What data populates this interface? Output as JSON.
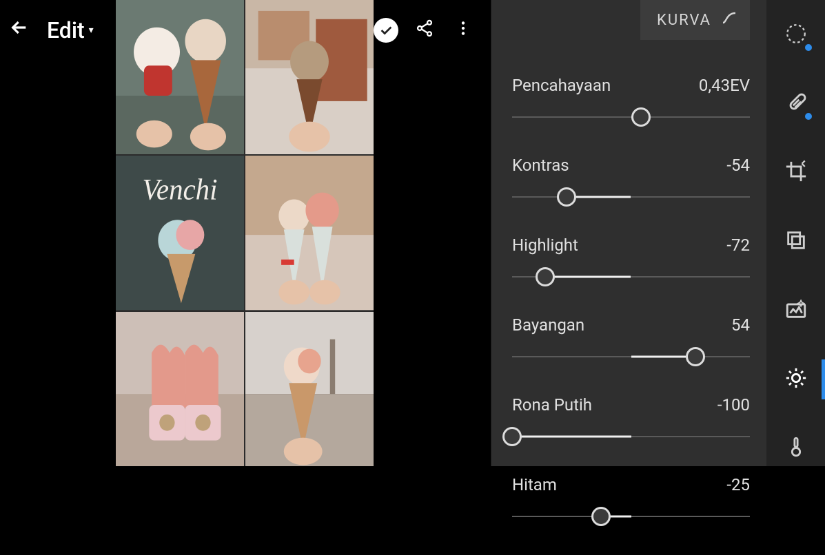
{
  "topbar": {
    "title": "Edit"
  },
  "tab": {
    "label": "KURVA"
  },
  "sliders": [
    {
      "label": "Pencahayaan",
      "value_text": "0,43EV",
      "min": -5,
      "max": 5,
      "value": 0.43
    },
    {
      "label": "Kontras",
      "value_text": "-54",
      "min": -100,
      "max": 100,
      "value": -54
    },
    {
      "label": "Highlight",
      "value_text": "-72",
      "min": -100,
      "max": 100,
      "value": -72
    },
    {
      "label": "Bayangan",
      "value_text": "54",
      "min": -100,
      "max": 100,
      "value": 54
    },
    {
      "label": "Rona Putih",
      "value_text": "-100",
      "min": -100,
      "max": 100,
      "value": -100
    },
    {
      "label": "Hitam",
      "value_text": "-25",
      "min": -100,
      "max": 100,
      "value": -25
    }
  ],
  "tools": [
    {
      "name": "masking-icon",
      "badge": true,
      "active": false
    },
    {
      "name": "healing-icon",
      "badge": true,
      "active": false
    },
    {
      "name": "crop-icon",
      "badge": false,
      "active": false
    },
    {
      "name": "versions-icon",
      "badge": false,
      "active": false
    },
    {
      "name": "presets-icon",
      "badge": false,
      "active": false
    },
    {
      "name": "light-icon",
      "badge": false,
      "active": true
    },
    {
      "name": "color-icon",
      "badge": false,
      "active": false
    }
  ]
}
